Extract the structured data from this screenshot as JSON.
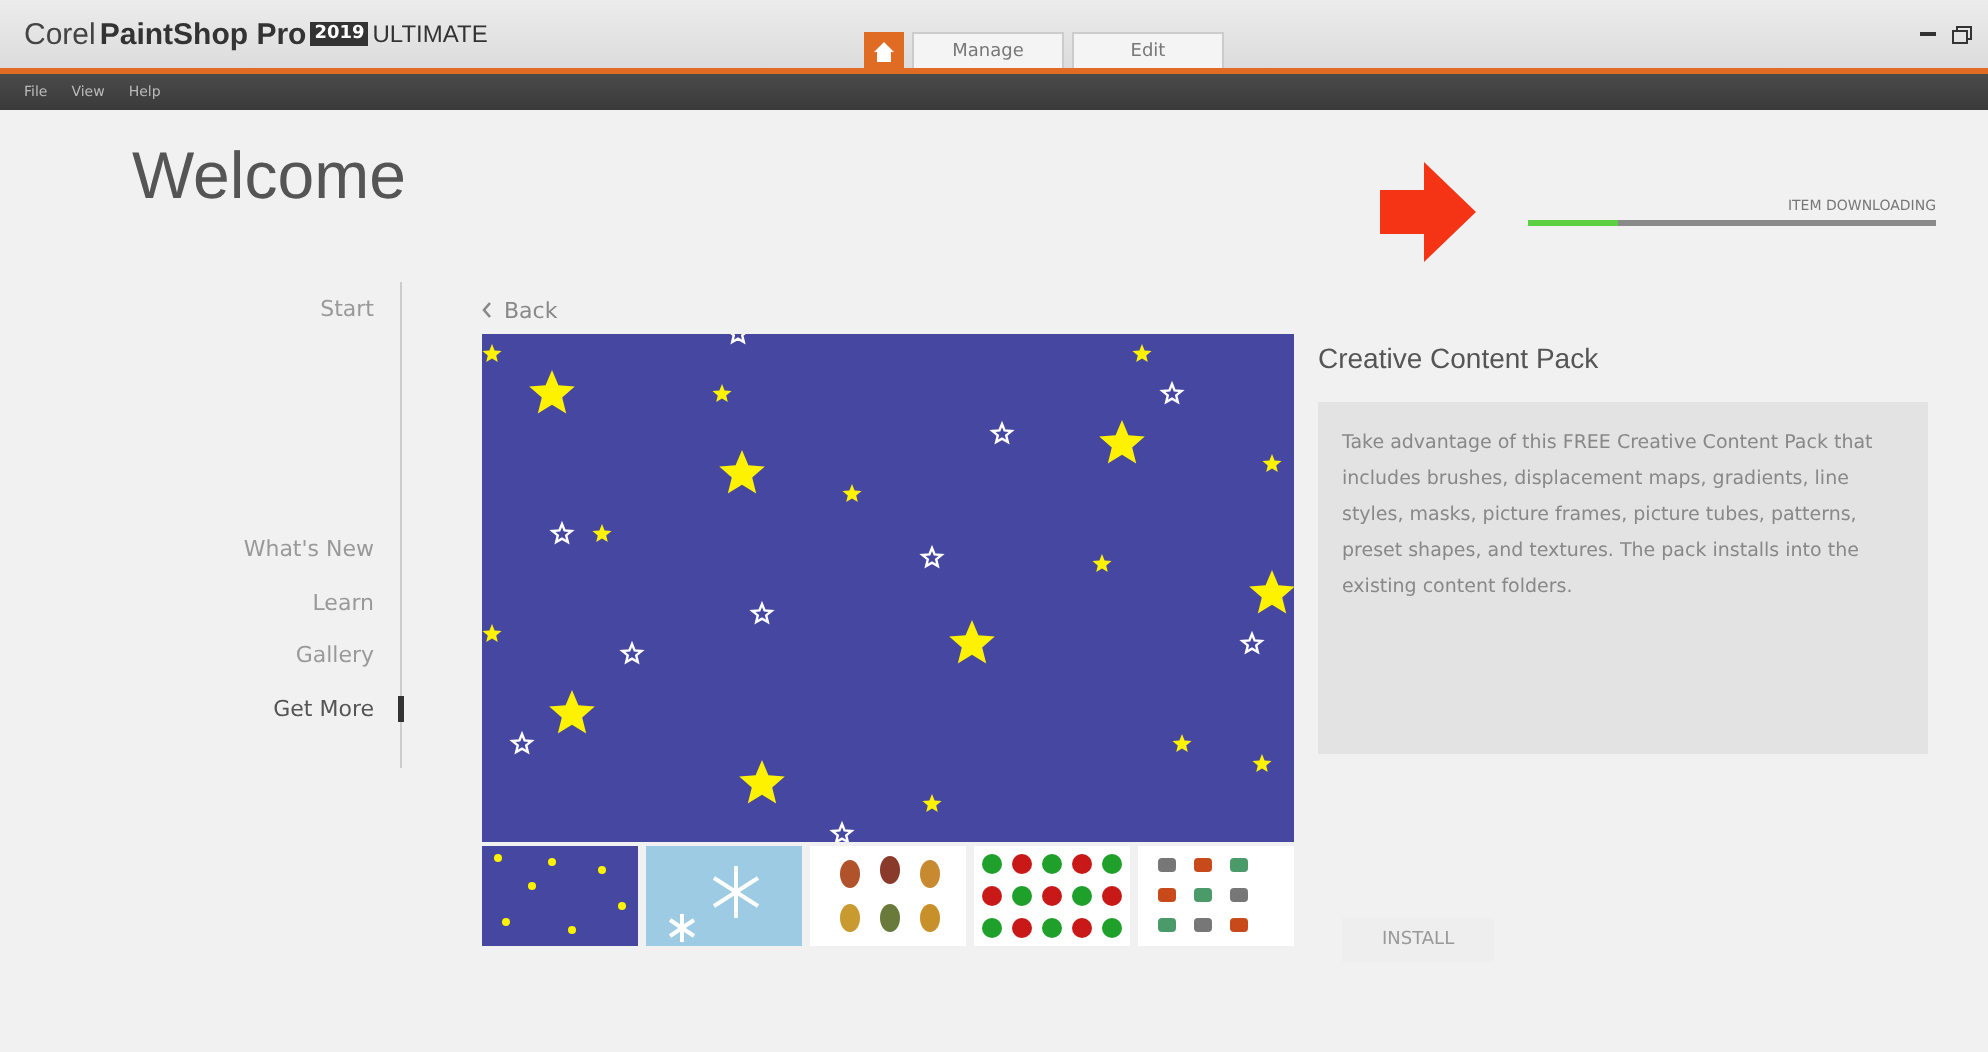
{
  "window": {
    "brand": "Corel",
    "product": "PaintShop Pro",
    "year": "2019",
    "edition": "ULTIMATE"
  },
  "tabs": [
    {
      "kind": "home",
      "selected": true
    },
    {
      "kind": "text",
      "label": "Manage",
      "selected": false
    },
    {
      "kind": "text",
      "label": "Edit",
      "selected": false
    }
  ],
  "menu": [
    "File",
    "View",
    "Help"
  ],
  "page_title": "Welcome",
  "download": {
    "label": "ITEM DOWNLOADING",
    "level": 0.22
  },
  "nav": [
    {
      "label": "Start",
      "selected": false
    },
    {
      "label": "What's New",
      "selected": false
    },
    {
      "label": "Learn",
      "selected": false
    },
    {
      "label": "Gallery",
      "selected": false
    },
    {
      "label": "Get More",
      "selected": true
    }
  ],
  "back": "Back",
  "product": {
    "title": "Creative Content Pack",
    "description": "Take advantage of this FREE Creative Content Pack that includes brushes, displacement maps, gradients, line styles, masks, picture frames, picture tubes, patterns, preset shapes, and textures. The pack installs into the existing content folders.",
    "install": "INSTALL"
  },
  "thumbnails": [
    {
      "kind": "stars"
    },
    {
      "kind": "snow"
    },
    {
      "kind": "leaves"
    },
    {
      "kind": "balls"
    },
    {
      "kind": "objects"
    }
  ]
}
